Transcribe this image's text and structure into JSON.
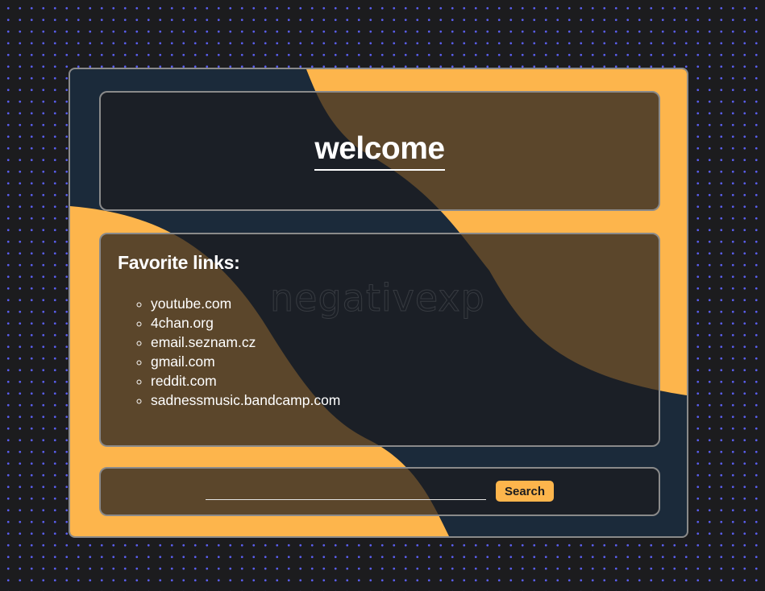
{
  "header": {
    "title": "welcome"
  },
  "links_section": {
    "heading": "Favorite links:",
    "watermark": "negativexp",
    "items": [
      "youtube.com",
      "4chan.org",
      "email.seznam.cz",
      "gmail.com",
      "reddit.com",
      "sadnessmusic.bandcamp.com"
    ]
  },
  "search": {
    "value": "",
    "placeholder": "",
    "button_label": "Search"
  },
  "colors": {
    "accent": "#fdb54c",
    "navy": "#1b2a3a",
    "page_background": "#1c1c1e",
    "dot_pattern": "#5a5ef0"
  }
}
